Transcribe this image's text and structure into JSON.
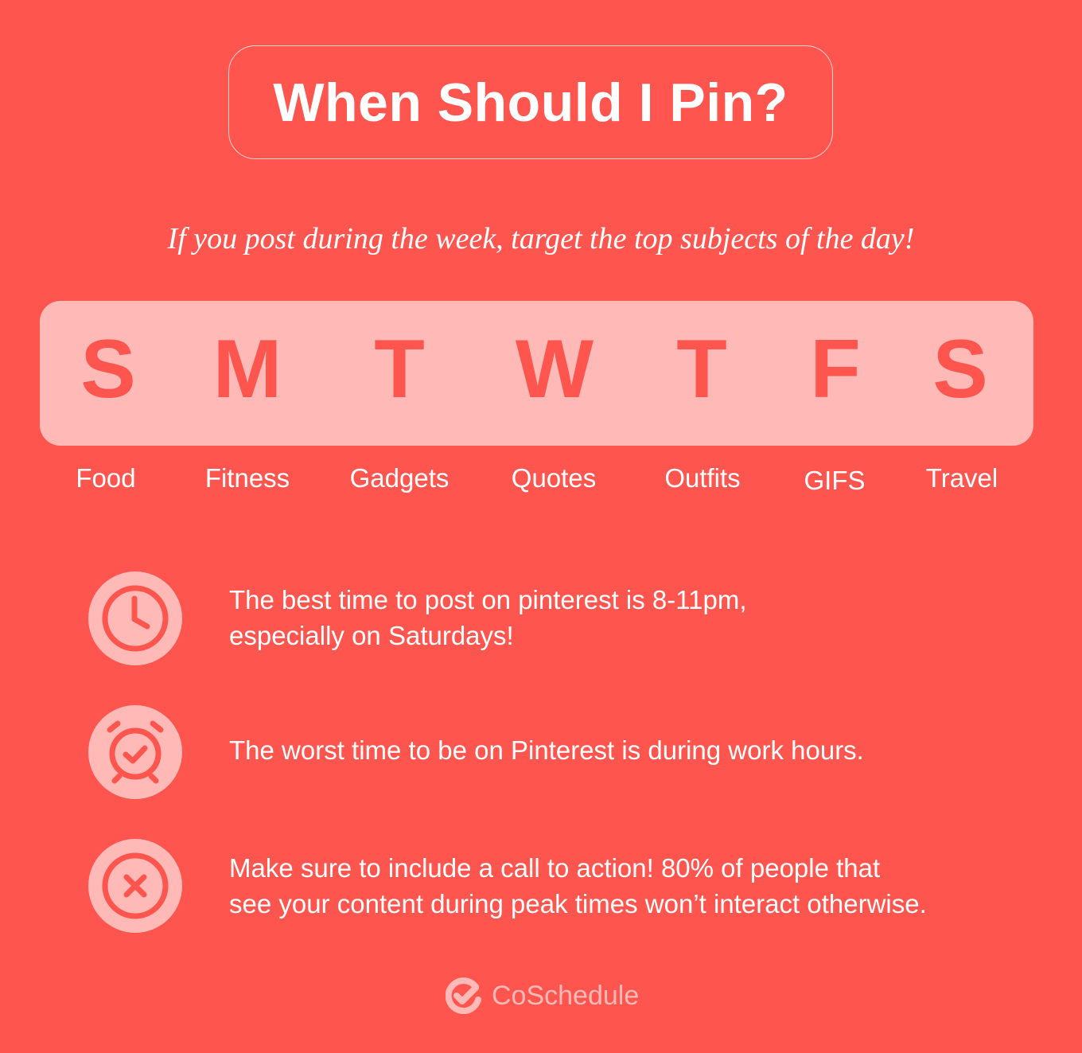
{
  "title": "When Should I Pin?",
  "subtitle": "If you post during the week, target the top subjects of the day!",
  "days": [
    {
      "letter": "S",
      "topic": "Food"
    },
    {
      "letter": "M",
      "topic": "Fitness"
    },
    {
      "letter": "T",
      "topic": "Gadgets"
    },
    {
      "letter": "W",
      "topic": "Quotes"
    },
    {
      "letter": "T",
      "topic": "Outfits"
    },
    {
      "letter": "F",
      "topic": "GIFS"
    },
    {
      "letter": "S",
      "topic": "Travel"
    }
  ],
  "tips": [
    {
      "icon": "clock-icon",
      "lines": [
        "The best time to post on pinterest is 8-11pm,",
        "especially on Saturdays!"
      ]
    },
    {
      "icon": "alarm-clock-check-icon",
      "lines": [
        "The worst time to be on Pinterest is during work hours."
      ]
    },
    {
      "icon": "x-circle-icon",
      "lines": [
        "Make sure to include a call to action! 80% of people that",
        "see your content during peak times won’t interact otherwise."
      ]
    }
  ],
  "brand": {
    "name": "CoSchedule",
    "icon": "coschedule-check-logo-icon"
  },
  "colors": {
    "background": "#ff554f",
    "panel": "#ffbab8",
    "text": "#ffffff"
  }
}
